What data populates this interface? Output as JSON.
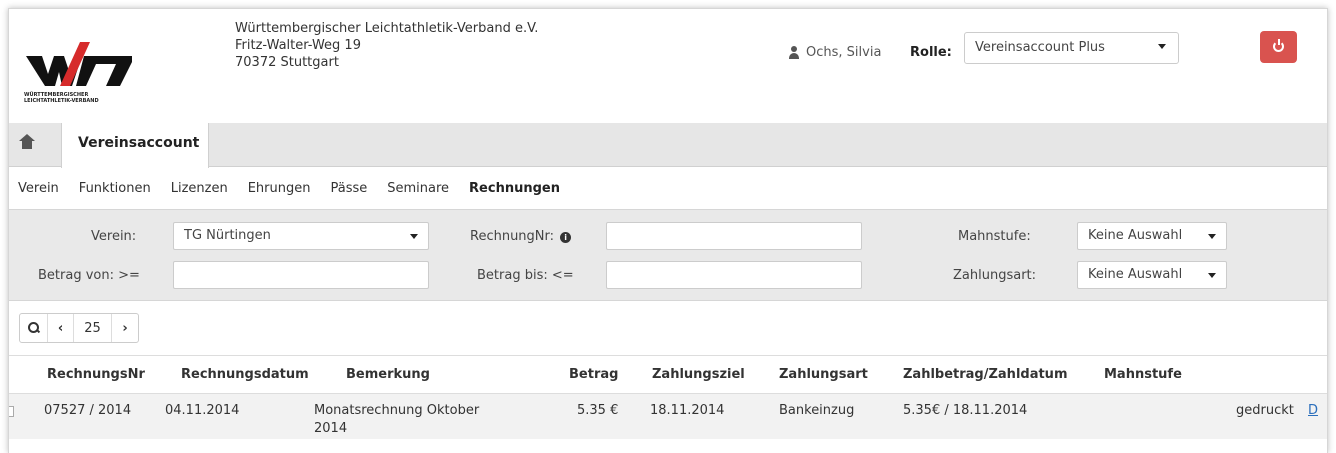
{
  "header": {
    "logo_text": "WÜRTTEMBERGISCHER LEICHTATHLETIK-VERBAND",
    "org_name": "Württembergischer Leichtathletik-Verband e.V.",
    "org_street": "Fritz-Walter-Weg 19",
    "org_city": "70372 Stuttgart",
    "user_name": "Ochs, Silvia",
    "rolle_label": "Rolle:",
    "rolle_value": "Vereinsaccount Plus",
    "logout_color": "#d9534f"
  },
  "tabs": {
    "active": "Vereinsaccount"
  },
  "subnav": [
    "Verein",
    "Funktionen",
    "Lizenzen",
    "Ehrungen",
    "Pässe",
    "Seminare",
    "Rechnungen"
  ],
  "filters": {
    "verein_label": "Verein:",
    "verein_value": "TG Nürtingen",
    "rechnungnr_label": "RechnungNr:",
    "rechnungnr_value": "",
    "mahnstufe_label": "Mahnstufe:",
    "mahnstufe_value": "Keine Auswahl",
    "betrag_von_label": "Betrag von: >=",
    "betrag_von_value": "",
    "betrag_bis_label": "Betrag bis: <=",
    "betrag_bis_value": "",
    "zahlungsart_label": "Zahlungsart:",
    "zahlungsart_value": "Keine Auswahl"
  },
  "pager": {
    "page_size": "25"
  },
  "table": {
    "columns": [
      "RechnungsNr",
      "Rechnungsdatum",
      "Bemerkung",
      "Betrag",
      "Zahlungsziel",
      "Zahlungsart",
      "Zahlbetrag/Zahldatum",
      "Mahnstufe"
    ],
    "rows": [
      {
        "nr": "07527 / 2014",
        "datum": "04.11.2014",
        "bemerkung_1": "Monatsrechnung Oktober",
        "bemerkung_2": "2014",
        "betrag": "5.35 €",
        "zahlungsziel": "18.11.2014",
        "zahlungsart": "Bankeinzug",
        "zahlbetrag": "5.35€ / 18.11.2014",
        "mahnstufe": "",
        "status": "gedruckt",
        "link": "D"
      }
    ]
  }
}
